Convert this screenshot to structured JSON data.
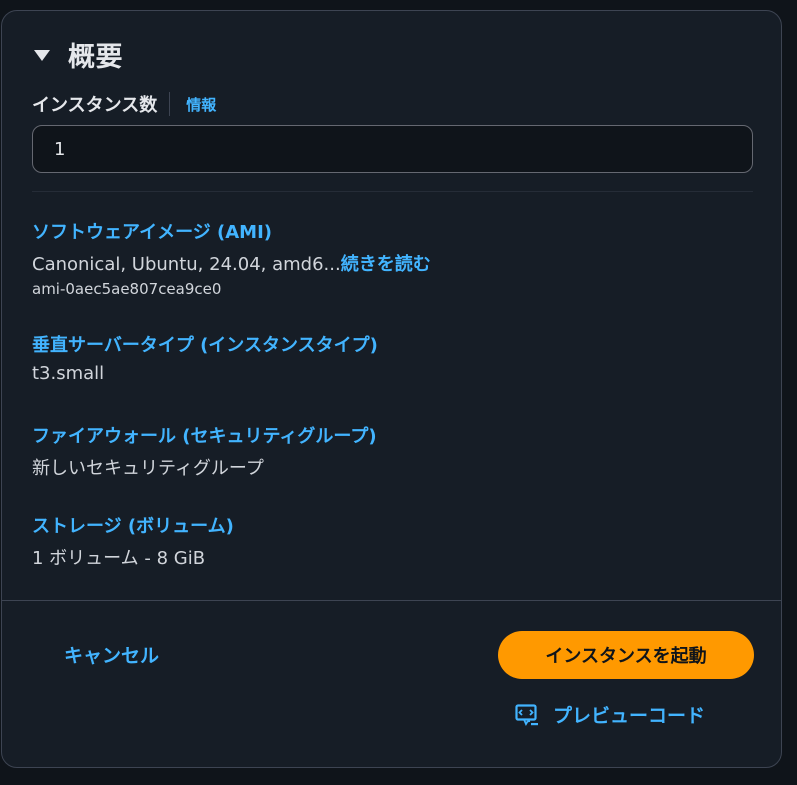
{
  "summary": {
    "title": "概要",
    "instance_count": {
      "label": "インスタンス数",
      "info_link": "情報",
      "value": "1"
    },
    "ami": {
      "title": "ソフトウェアイメージ (AMI)",
      "value": "Canonical, Ubuntu, 24.04, amd6...",
      "read_more": "続きを読む",
      "id": "ami-0aec5ae807cea9ce0"
    },
    "instance_type": {
      "title": "垂直サーバータイプ (インスタンスタイプ)",
      "value": "t3.small"
    },
    "firewall": {
      "title": "ファイアウォール (セキュリティグループ)",
      "value": "新しいセキュリティグループ"
    },
    "storage": {
      "title": "ストレージ (ボリューム)",
      "value": "1 ボリューム - 8 GiB"
    }
  },
  "footer": {
    "cancel_label": "キャンセル",
    "launch_label": "インスタンスを起動",
    "preview_label": "プレビューコード",
    "preview_icon": "code-preview-icon"
  },
  "colors": {
    "accent": "#42b4ff",
    "primary_button": "#ff9900",
    "panel_bg": "#161d26"
  }
}
